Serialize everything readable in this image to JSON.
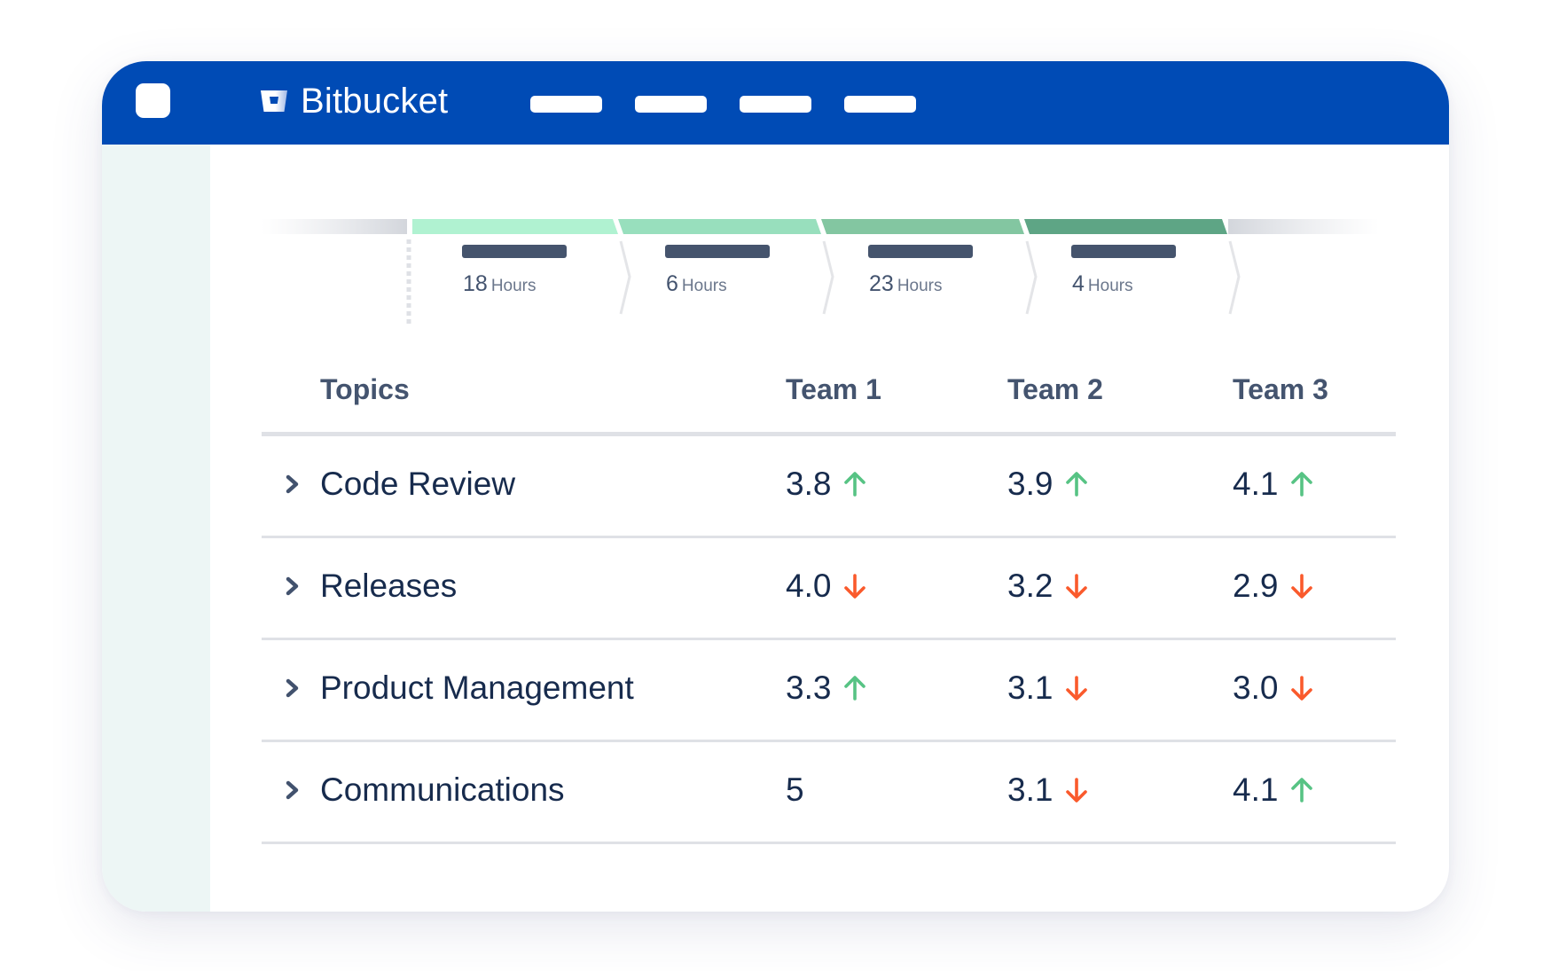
{
  "header": {
    "app_name": "Bitbucket",
    "brand_color": "#004bb5",
    "app_switcher_icon": "app-switcher-icon",
    "logo_icon": "bitbucket-logo-icon",
    "nav_placeholders": 4
  },
  "timeline": {
    "stage_colors": [
      "#b0f2d1",
      "#98dfbd",
      "#83c6a1",
      "#5ea585"
    ],
    "stages": [
      {
        "hours": "18",
        "unit": "Hours"
      },
      {
        "hours": "6",
        "unit": "Hours"
      },
      {
        "hours": "23",
        "unit": "Hours"
      },
      {
        "hours": "4",
        "unit": "Hours"
      }
    ]
  },
  "table": {
    "headers": [
      "Topics",
      "Team 1",
      "Team 2",
      "Team 3"
    ],
    "trend_colors": {
      "up": "#57c384",
      "down": "#fa5a2c"
    },
    "rows": [
      {
        "topic": "Code Review",
        "cells": [
          {
            "value": "3.8",
            "trend": "up"
          },
          {
            "value": "3.9",
            "trend": "up"
          },
          {
            "value": "4.1",
            "trend": "up"
          }
        ]
      },
      {
        "topic": "Releases",
        "cells": [
          {
            "value": "4.0",
            "trend": "down"
          },
          {
            "value": "3.2",
            "trend": "down"
          },
          {
            "value": "2.9",
            "trend": "down"
          }
        ]
      },
      {
        "topic": "Product Management",
        "cells": [
          {
            "value": "3.3",
            "trend": "up"
          },
          {
            "value": "3.1",
            "trend": "down"
          },
          {
            "value": "3.0",
            "trend": "down"
          }
        ]
      },
      {
        "topic": "Communications",
        "cells": [
          {
            "value": "5",
            "trend": "none"
          },
          {
            "value": "3.1",
            "trend": "down"
          },
          {
            "value": "4.1",
            "trend": "up"
          }
        ]
      }
    ]
  }
}
